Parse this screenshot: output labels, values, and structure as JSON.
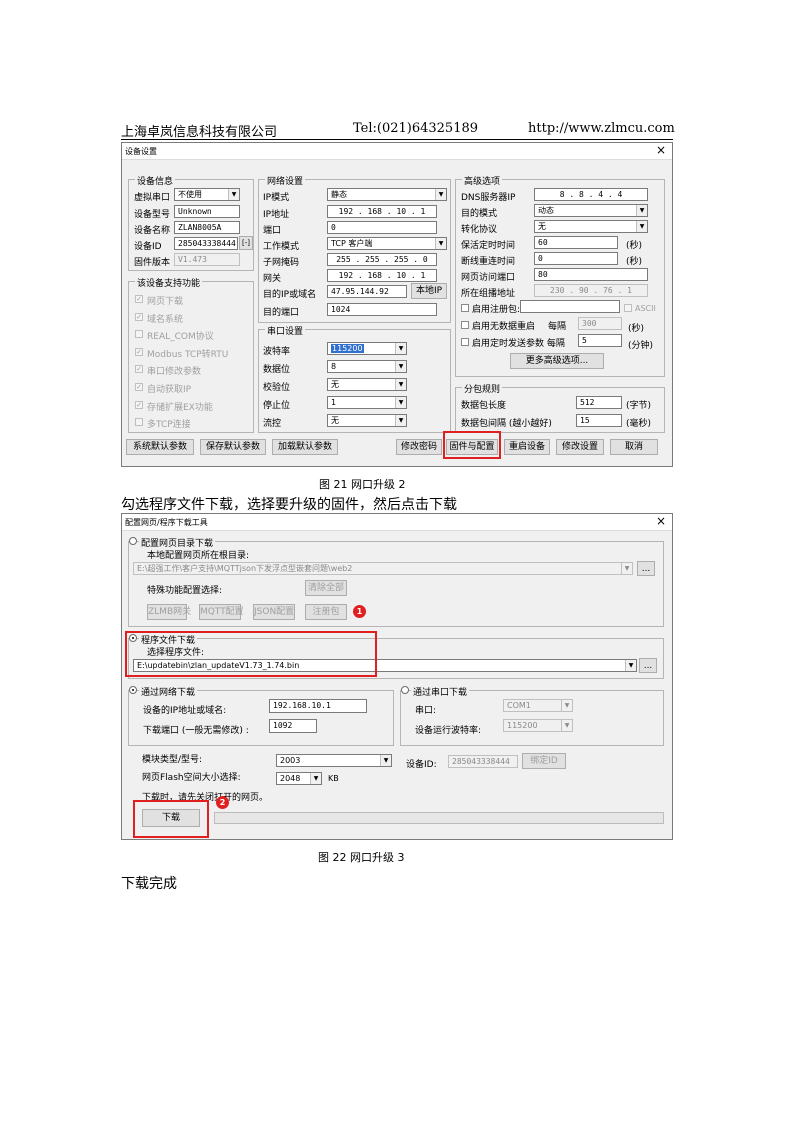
{
  "header": {
    "company": "上海卓岚信息科技有限公司",
    "tel": "Tel:(021)64325189",
    "url": "http://www.zlmcu.com"
  },
  "dialog1": {
    "title": "设备设置",
    "close": "×",
    "device_info": {
      "title": "设备信息",
      "virtual_port_label": "虚拟串口",
      "virtual_port_value": "不使用",
      "model_label": "设备型号",
      "model_value": "Unknown",
      "name_label": "设备名称",
      "name_value": "ZLAN8005A",
      "id_label": "设备ID",
      "id_value": "285043338444",
      "id_btn": "[-]",
      "fw_label": "固件版本",
      "fw_value": "V1.473"
    },
    "features": {
      "title": "该设备支持功能",
      "items": [
        "网页下载",
        "域名系统",
        "REAL_COM协议",
        "Modbus TCP转RTU",
        "串口修改参数",
        "自动获取IP",
        "存储扩展EX功能",
        "多TCP连接"
      ],
      "checked": [
        true,
        true,
        false,
        true,
        true,
        true,
        true,
        false
      ]
    },
    "network": {
      "title": "网络设置",
      "ip_mode_label": "IP模式",
      "ip_mode_value": "静态",
      "ip_label": "IP地址",
      "ip_value": "192 . 168 . 10 . 1",
      "port_label": "端口",
      "port_value": "0",
      "work_mode_label": "工作模式",
      "work_mode_value": "TCP 客户端",
      "mask_label": "子网掩码",
      "mask_value": "255 . 255 . 255 . 0",
      "gw_label": "网关",
      "gw_value": "192 . 168 . 10 . 1",
      "dest_ip_label": "目的IP或域名",
      "dest_ip_value": "47.95.144.92",
      "local_ip_btn": "本地IP",
      "dest_port_label": "目的端口",
      "dest_port_value": "1024"
    },
    "serial": {
      "title": "串口设置",
      "baud_label": "波特率",
      "baud_value": "115200",
      "data_label": "数据位",
      "data_value": "8",
      "parity_label": "校验位",
      "parity_value": "无",
      "stop_label": "停止位",
      "stop_value": "1",
      "flow_label": "流控",
      "flow_value": "无"
    },
    "advanced": {
      "title": "高级选项",
      "dns_label": "DNS服务器IP",
      "dns_value": "8 . 8 . 4 . 4",
      "dest_mode_label": "目的模式",
      "dest_mode_value": "动态",
      "proto_label": "转化协议",
      "proto_value": "无",
      "keepalive_label": "保活定时时间",
      "keepalive_value": "60",
      "keepalive_unit": "(秒)",
      "reconnect_label": "断线重连时间",
      "reconnect_value": "0",
      "reconnect_unit": "(秒)",
      "web_port_label": "网页访问端口",
      "web_port_value": "80",
      "multicast_label": "所在组播地址",
      "multicast_value": "230 . 90 . 76 . 1",
      "reg_label": "启用注册包:",
      "ascii_label": "ASCII",
      "noreboot_label": "启用无数据重启",
      "every_label": "每隔",
      "noreboot_value": "300",
      "noreboot_unit": "(秒)",
      "timed_label": "启用定时发送参数 每隔",
      "timed_value": "5",
      "timed_unit": "(分钟)",
      "more_btn": "更多高级选项..."
    },
    "packet": {
      "title": "分包规则",
      "len_label": "数据包长度",
      "len_value": "512",
      "len_unit": "(字节)",
      "interval_label": "数据包间隔 (越小越好)",
      "interval_value": "15",
      "interval_unit": "(毫秒)"
    },
    "buttons": {
      "sys_default": "系统默认参数",
      "save_default": "保存默认参数",
      "load_default": "加载默认参数",
      "change_pwd": "修改密码",
      "firmware": "固件与配置",
      "restart": "重启设备",
      "modify": "修改设置",
      "cancel": "取消"
    }
  },
  "caption1": "图 21 网口升级 2",
  "instruction": "勾选程序文件下载，选择要升级的固件，然后点击下载",
  "dialog2": {
    "title": "配置网页/程序下载工具",
    "close": "×",
    "web_download": {
      "title": "配置网页目录下载",
      "root_label": "本地配置网页所在根目录:",
      "root_path": "E:\\超强工作\\客户支持\\MQTTjson下发浮点型嵌套问题\\web2",
      "browse": "...",
      "special_label": "特殊功能配置选择:",
      "clear_btn": "清除全部",
      "zlmb_btn": "ZLMB网关",
      "mqtt_btn": "MQTT配置",
      "json_btn": "JSON配置",
      "reg_btn": "注册包",
      "badge1": "1"
    },
    "program_download": {
      "title": "程序文件下载",
      "select_label": "选择程序文件:",
      "file_path": "E:\\updatebin\\zlan_updateV1.73_1.74.bin",
      "browse": "..."
    },
    "net_download": {
      "title": "通过网络下载",
      "ip_label": "设备的IP地址或域名:",
      "ip_value": "192.168.10.1",
      "port_label": "下载端口 (一般无需修改) :",
      "port_value": "1092"
    },
    "serial_download": {
      "title": "通过串口下载",
      "port_label": "串口:",
      "port_value": "COM1",
      "baud_label": "设备运行波特率:",
      "baud_value": "115200"
    },
    "model_label": "模块类型/型号:",
    "model_value": "2003",
    "device_id_label": "设备ID:",
    "device_id_value": "285043338444",
    "bind_btn": "绑定ID",
    "flash_label": "网页Flash空间大小选择:",
    "flash_value": "2048",
    "flash_unit": "KB",
    "warning": "下载时，请先关闭打开的网页。",
    "badge2": "2",
    "download_btn": "下载"
  },
  "caption2": "图 22 网口升级 3",
  "done": "下载完成"
}
